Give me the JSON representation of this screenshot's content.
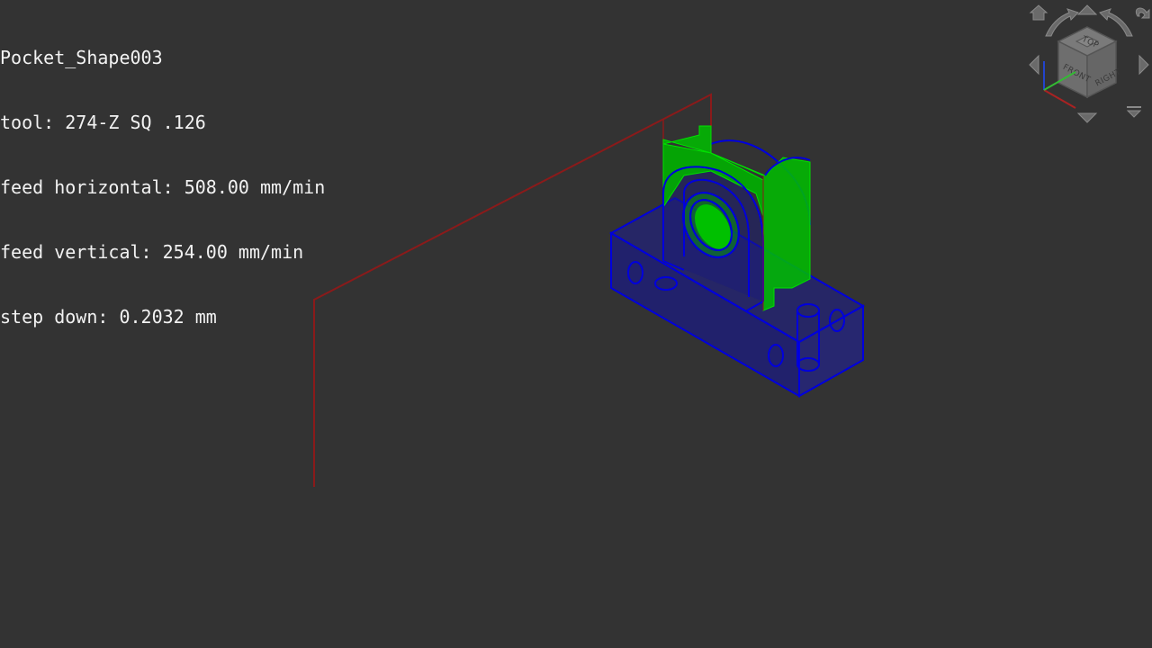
{
  "overlay": {
    "operation": "Pocket_Shape003",
    "tool": "tool: 274-Z SQ .126",
    "feed_horizontal": "feed horizontal: 508.00 mm/min",
    "feed_vertical": "feed vertical: 254.00 mm/min",
    "step_down": "step down: 0.2032 mm"
  },
  "navcube": {
    "face_top": "TOP",
    "face_front": "FRONT",
    "face_right": "RIGHT"
  },
  "colors": {
    "background": "#333333",
    "model_edges": "#0000cc",
    "model_fill": "#1a1a8c",
    "toolpath": "#00c800",
    "rapid_move": "#8b1a1a",
    "overlay_text": "#f2f2f2"
  }
}
